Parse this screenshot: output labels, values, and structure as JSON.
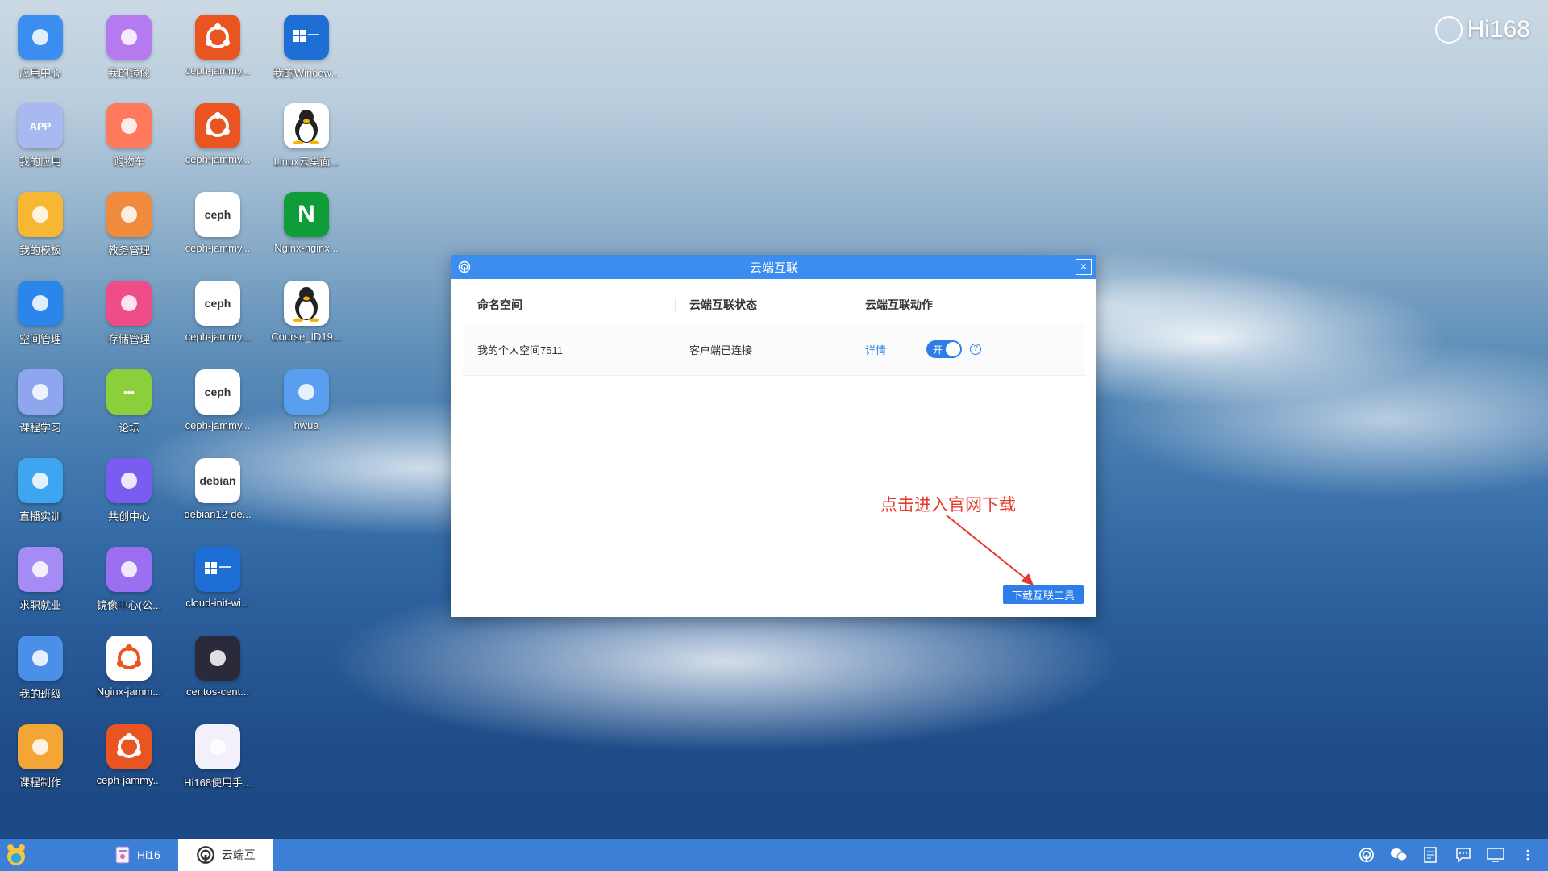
{
  "brand": {
    "text": "Hi168"
  },
  "desktop": {
    "icons": [
      {
        "label": "应用中心",
        "icon": "app-center-icon",
        "color": "#3b8ef0"
      },
      {
        "label": "我的应用",
        "icon": "my-apps-icon",
        "color": "#a8b8f0",
        "glyph": "APP"
      },
      {
        "label": "我的模板",
        "icon": "folder-icon",
        "color": "#f7b733"
      },
      {
        "label": "空间管理",
        "icon": "space-icon",
        "color": "#2a86e8"
      },
      {
        "label": "课程学习",
        "icon": "course-icon",
        "color": "#8fa6ee"
      },
      {
        "label": "直播实训",
        "icon": "live-icon",
        "color": "#3ea6f0"
      },
      {
        "label": "求职就业",
        "icon": "job-icon",
        "color": "#a78bf5"
      },
      {
        "label": "我的班级",
        "icon": "class-icon",
        "color": "#4a8fe8"
      },
      {
        "label": "课程制作",
        "icon": "course-make-icon",
        "color": "#f3a536"
      },
      {
        "label": "我的镜像",
        "icon": "mirror-icon",
        "color": "#b57af0"
      },
      {
        "label": "购物车",
        "icon": "cart-icon",
        "color": "#ff7a5c"
      },
      {
        "label": "教务管理",
        "icon": "admin-icon",
        "color": "#f08a3c"
      },
      {
        "label": "存储管理",
        "icon": "storage-icon",
        "color": "#ef4d8a"
      },
      {
        "label": "论坛",
        "icon": "forum-icon",
        "color": "#8bcf3a",
        "glyph": "•••"
      },
      {
        "label": "共创中心",
        "icon": "cocreate-icon",
        "color": "#7b5cf0"
      },
      {
        "label": "镜像中心(公...",
        "icon": "mirror-center-icon",
        "color": "#9c6ef2"
      },
      {
        "label": "Nginx-jamm...",
        "icon": "ubuntu-icon",
        "color": "#ffffff"
      },
      {
        "label": "ceph-jammy...",
        "icon": "ubuntu-icon",
        "color": "#e95420"
      },
      {
        "label": "ceph-jammy...",
        "icon": "ubuntu-icon",
        "color": "#e95420"
      },
      {
        "label": "ceph-jammy...",
        "icon": "ubuntu-icon",
        "color": "#e95420"
      },
      {
        "label": "ceph-jammy...",
        "icon": "ceph-icon",
        "color": "#ffffff",
        "glyph": "ceph"
      },
      {
        "label": "ceph-jammy...",
        "icon": "ceph-icon",
        "color": "#ffffff",
        "glyph": "ceph"
      },
      {
        "label": "ceph-jammy...",
        "icon": "ceph-icon",
        "color": "#ffffff",
        "glyph": "ceph"
      },
      {
        "label": "debian12-de...",
        "icon": "debian-icon",
        "color": "#ffffff",
        "glyph": "debian"
      },
      {
        "label": "cloud-init-wi...",
        "icon": "windows-icon",
        "color": "#1d6fd6"
      },
      {
        "label": "centos-cent...",
        "icon": "centos-icon",
        "color": "#2a2a3a"
      },
      {
        "label": "Hi168使用手...",
        "icon": "manual-icon",
        "color": "#f2f0fa"
      },
      {
        "label": "我的Window...",
        "icon": "windows-icon",
        "color": "#1d6fd6"
      },
      {
        "label": "Linux云桌面...",
        "icon": "linux-icon",
        "color": "#ffffff"
      },
      {
        "label": "Nginx-nginx...",
        "icon": "nginx-icon",
        "color": "#0f9d3a",
        "glyph": "N"
      },
      {
        "label": "Course_ID19...",
        "icon": "linux-icon",
        "color": "#ffffff"
      },
      {
        "label": "hwua",
        "icon": "hwua-icon",
        "color": "#5a9ef0"
      }
    ]
  },
  "dialog": {
    "title": "云端互联",
    "close_glyph": "×",
    "columns": [
      "命名空间",
      "云端互联状态",
      "云端互联动作"
    ],
    "rows": [
      {
        "namespace": "我的个人空间7511",
        "status": "客户端已连接",
        "detail_link": "详情",
        "toggle_label": "开",
        "toggle_on": true,
        "help_glyph": "?"
      }
    ],
    "annotation": "点击进入官网下载",
    "download_button": "下载互联工具",
    "accent_color": "#3c8df0"
  },
  "taskbar": {
    "items": [
      {
        "label": "Hi16",
        "active": false,
        "icon": "hi168-book-icon"
      },
      {
        "label": "云端互",
        "active": true,
        "icon": "cloud-link-icon"
      }
    ],
    "tray": [
      "cloud-link-icon",
      "wechat-icon",
      "notes-icon",
      "chat-icon",
      "monitor-icon",
      "more-icon"
    ]
  }
}
